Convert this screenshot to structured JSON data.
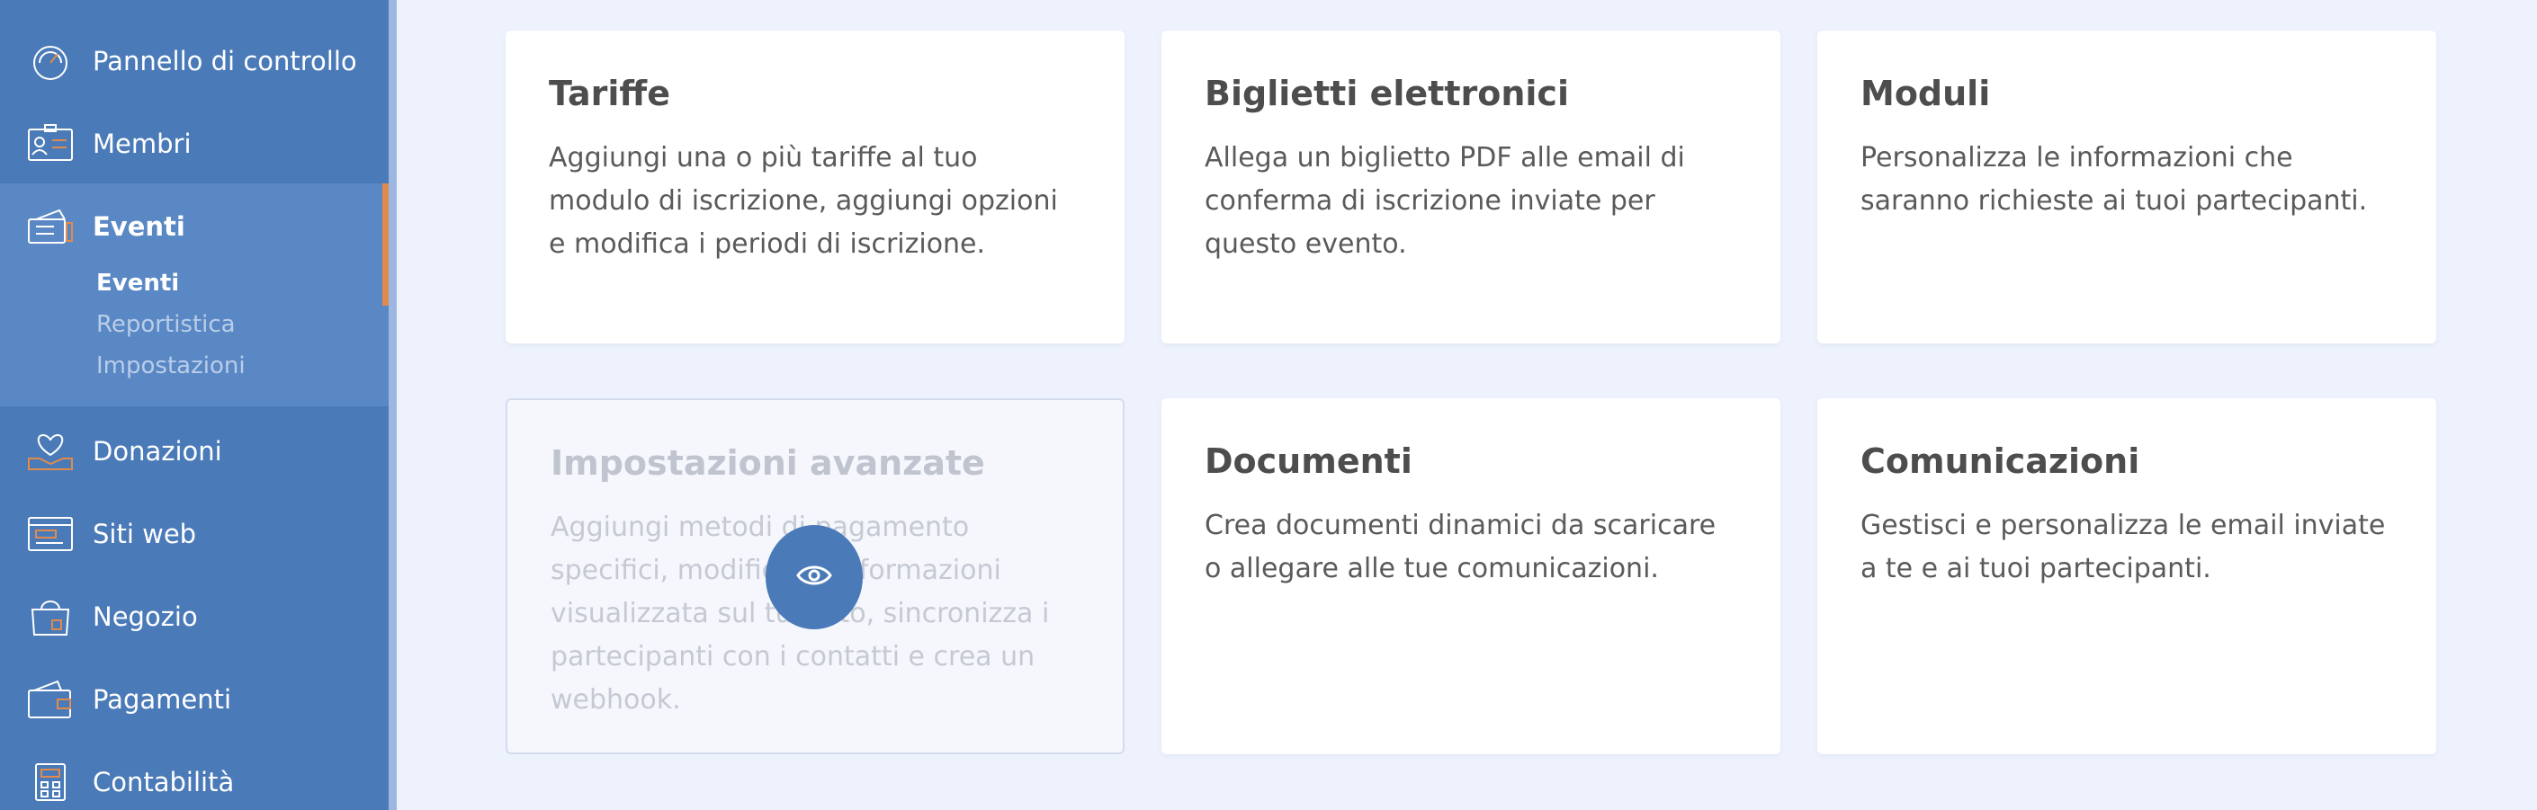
{
  "sidebar": {
    "items": [
      {
        "label": "Pannello di controllo",
        "icon": "dashboard-gauge-icon"
      },
      {
        "label": "Membri",
        "icon": "member-card-icon"
      },
      {
        "label": "Eventi",
        "icon": "tickets-icon"
      },
      {
        "label": "Donazioni",
        "icon": "heart-hand-icon"
      },
      {
        "label": "Siti web",
        "icon": "website-icon"
      },
      {
        "label": "Negozio",
        "icon": "shopping-bag-icon"
      },
      {
        "label": "Pagamenti",
        "icon": "wallet-icon"
      },
      {
        "label": "Contabilità",
        "icon": "calculator-icon"
      }
    ],
    "sub_items": [
      {
        "label": "Eventi",
        "active": true
      },
      {
        "label": "Reportistica",
        "active": false
      },
      {
        "label": "Impostazioni",
        "active": false
      }
    ]
  },
  "cards": [
    {
      "title": "Tariffe",
      "text": "Aggiungi una o più tariffe al tuo modulo di iscrizione, aggiungi opzioni e modifica i periodi di iscrizione."
    },
    {
      "title": "Biglietti elettronici",
      "text": "Allega un biglietto PDF alle email di conferma di iscrizione inviate per questo evento."
    },
    {
      "title": "Moduli",
      "text": "Personalizza le informazioni che saranno richieste ai tuoi partecipanti."
    },
    {
      "title": "Impostazioni avanzate",
      "text": "Aggiungi metodi di pagamento specifici, modifica le informazioni visualizzata sul tuo sito, sincronizza i partecipanti con i contatti e crea un webhook."
    },
    {
      "title": "Documenti",
      "text": "Crea documenti dinamici da scaricare o allegare alle tue comunicazioni."
    },
    {
      "title": "Comunicazioni",
      "text": "Gestisci e personalizza le email inviate a te e ai tuoi partecipanti."
    }
  ],
  "colors": {
    "sidebar": "#4a7ab8",
    "active_accent": "#e08b4e",
    "background": "#eef2fc"
  }
}
